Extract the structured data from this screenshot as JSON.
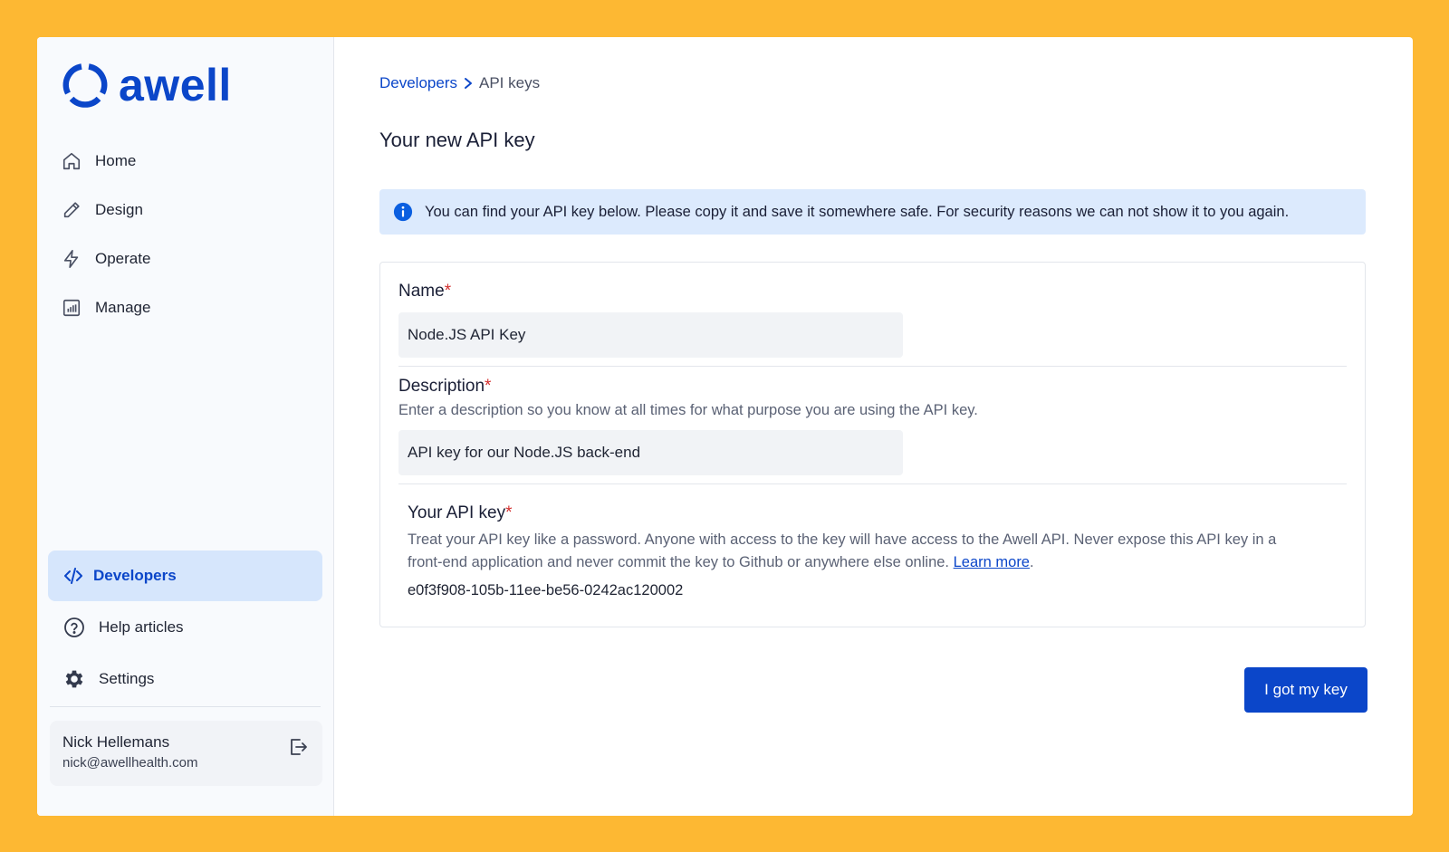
{
  "app": {
    "logo_text": "awell",
    "brand_color": "#0b46c9",
    "background_color": "#FDB833"
  },
  "sidebar": {
    "items": [
      {
        "label": "Home",
        "icon": "home-icon"
      },
      {
        "label": "Design",
        "icon": "pencil-icon"
      },
      {
        "label": "Operate",
        "icon": "lightning-icon"
      },
      {
        "label": "Manage",
        "icon": "bar-chart-icon"
      }
    ],
    "bottom_items": [
      {
        "label": "Developers",
        "icon": "code-icon",
        "active": true
      },
      {
        "label": "Help articles",
        "icon": "help-circle-icon"
      },
      {
        "label": "Settings",
        "icon": "gear-icon"
      }
    ],
    "user": {
      "name": "Nick Hellemans",
      "email": "nick@awellhealth.com"
    }
  },
  "breadcrumb": {
    "parent": "Developers",
    "current": "API keys"
  },
  "page": {
    "title": "Your new API key"
  },
  "alert": {
    "text": "You can find your API key below. Please copy it and save it somewhere safe. For security reasons we can not show it to you again."
  },
  "form": {
    "name": {
      "label": "Name",
      "required_mark": "*",
      "value": "Node.JS API Key"
    },
    "description": {
      "label": "Description",
      "required_mark": "*",
      "hint": "Enter a description so you know at all times for what purpose you are using the API key.",
      "value": "API key for our Node.JS back-end"
    },
    "api_key": {
      "label": "Your API key",
      "required_mark": "*",
      "hint_line1": "Treat your API key like a password. Anyone with access to the key will have access to the Awell API. Never expose this API key in a",
      "hint_line2": "front-end application and never commit the key to Github or anywhere else online.",
      "learn_more": "Learn more",
      "hint_end": ".",
      "value": "e0f3f908-105b-11ee-be56-0242ac120002"
    }
  },
  "actions": {
    "confirm_label": "I got my key"
  }
}
